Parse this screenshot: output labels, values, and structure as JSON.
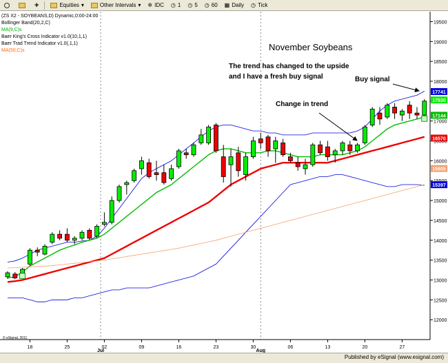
{
  "toolbar": {
    "items": [
      {
        "label": ""
      },
      {
        "label": ""
      },
      {
        "label": "Equities"
      },
      {
        "label": "Other Intervals"
      },
      {
        "label": "IDC"
      },
      {
        "label": "1"
      },
      {
        "label": "5"
      },
      {
        "label": "60"
      },
      {
        "label": "Daily"
      },
      {
        "label": "Tick"
      }
    ]
  },
  "footer": {
    "published": "Published by eSignal (www.esignal.com)"
  },
  "colors": {
    "up_candle": "#00ee00",
    "down_candle": "#ee0000",
    "bollinger": "#0000dd",
    "ma9": "#00bb00",
    "baer_trend": "#ee0000",
    "ma50": "#f4a070"
  },
  "chart_data": {
    "type": "candlestick",
    "legend": [
      {
        "text": "(ZS X2 - SOYBEANS,D) Dynamic,0:00-24:00",
        "color": "#000000"
      },
      {
        "text": "Bollinger Band(20,2,C)",
        "color": "#000000"
      },
      {
        "text": "MA(9,C)s",
        "color": "#00aa00"
      },
      {
        "text": "Baer King's Cross Indicator v1.0(10,1,1)",
        "color": "#000000"
      },
      {
        "text": "Baer Trad Trend Indicator v1.0(,1,1)",
        "color": "#000000"
      },
      {
        "text": "MA(50,C)s",
        "color": "#ff6600"
      }
    ],
    "annotations": [
      {
        "text": "November Soybeans"
      },
      {
        "text": "The trend has changed to the upside"
      },
      {
        "text": "and I have a fresh buy signal"
      },
      {
        "text": "Buy signal"
      },
      {
        "text": "Change in trend"
      }
    ],
    "copyright": "© eSignal, 2011",
    "ylim": [
      11500,
      19750
    ],
    "y_ticks": [
      12000,
      12500,
      13000,
      13500,
      14000,
      14500,
      15000,
      15500,
      16000,
      16500,
      17000,
      17500,
      18000,
      18500,
      19000,
      19500
    ],
    "y_tick_labels": [
      "12000",
      "12500",
      "13000",
      "13500",
      "14000",
      "14500",
      "15000",
      "15500",
      "16000",
      "16500",
      "17000",
      "17500",
      "18000",
      "18500",
      "19000",
      "19500"
    ],
    "x_ticks": [
      {
        "label": "18",
        "index": 3
      },
      {
        "label": "25",
        "index": 8
      },
      {
        "label": "02",
        "index": 13
      },
      {
        "label": "09",
        "index": 18
      },
      {
        "label": "16",
        "index": 23
      },
      {
        "label": "23",
        "index": 28
      },
      {
        "label": "30",
        "index": 33
      },
      {
        "label": "06",
        "index": 38
      },
      {
        "label": "13",
        "index": 43
      },
      {
        "label": "20",
        "index": 48
      },
      {
        "label": "27",
        "index": 53
      }
    ],
    "month_labels": [
      {
        "label": "Jul",
        "index": 13
      },
      {
        "label": "Aug",
        "index": 34.5
      }
    ],
    "month_dividers": [
      13,
      34.5
    ],
    "candles": [
      {
        "o": 13080,
        "h": 13220,
        "l": 13030,
        "c": 13180
      },
      {
        "o": 13150,
        "h": 13200,
        "l": 13020,
        "c": 13050
      },
      {
        "o": 13080,
        "h": 13300,
        "l": 13050,
        "c": 13270
      },
      {
        "o": 13400,
        "h": 13800,
        "l": 13350,
        "c": 13750
      },
      {
        "o": 13750,
        "h": 13820,
        "l": 13600,
        "c": 13700
      },
      {
        "o": 13650,
        "h": 13900,
        "l": 13620,
        "c": 13850
      },
      {
        "o": 13950,
        "h": 14200,
        "l": 13900,
        "c": 14150
      },
      {
        "o": 14150,
        "h": 14250,
        "l": 14000,
        "c": 14050
      },
      {
        "o": 14150,
        "h": 14300,
        "l": 13950,
        "c": 14000
      },
      {
        "o": 14000,
        "h": 14100,
        "l": 13900,
        "c": 14050
      },
      {
        "o": 14050,
        "h": 14250,
        "l": 14000,
        "c": 14200
      },
      {
        "o": 14250,
        "h": 14300,
        "l": 14000,
        "c": 14050
      },
      {
        "o": 14100,
        "h": 14400,
        "l": 14050,
        "c": 14350
      },
      {
        "o": 14400,
        "h": 14700,
        "l": 14350,
        "c": 14450
      },
      {
        "o": 14450,
        "h": 15100,
        "l": 14400,
        "c": 15000
      },
      {
        "o": 15000,
        "h": 15400,
        "l": 14950,
        "c": 15350
      },
      {
        "o": 15400,
        "h": 15500,
        "l": 15150,
        "c": 15450
      },
      {
        "o": 15500,
        "h": 15800,
        "l": 15450,
        "c": 15750
      },
      {
        "o": 15800,
        "h": 16100,
        "l": 15650,
        "c": 16000
      },
      {
        "o": 15950,
        "h": 16050,
        "l": 15550,
        "c": 15600
      },
      {
        "o": 15700,
        "h": 16000,
        "l": 15500,
        "c": 15650
      },
      {
        "o": 15700,
        "h": 15900,
        "l": 15400,
        "c": 15450
      },
      {
        "o": 15550,
        "h": 15900,
        "l": 15500,
        "c": 15800
      },
      {
        "o": 15850,
        "h": 16300,
        "l": 15800,
        "c": 16250
      },
      {
        "o": 16200,
        "h": 16300,
        "l": 16050,
        "c": 16150
      },
      {
        "o": 16150,
        "h": 16450,
        "l": 16100,
        "c": 16400
      },
      {
        "o": 16450,
        "h": 16800,
        "l": 16400,
        "c": 16650
      },
      {
        "o": 16450,
        "h": 16900,
        "l": 16400,
        "c": 16850
      },
      {
        "o": 16900,
        "h": 16950,
        "l": 16200,
        "c": 16250
      },
      {
        "o": 16100,
        "h": 16400,
        "l": 15450,
        "c": 15600
      },
      {
        "o": 15900,
        "h": 16300,
        "l": 15350,
        "c": 16100
      },
      {
        "o": 16200,
        "h": 16350,
        "l": 15600,
        "c": 15750
      },
      {
        "o": 15650,
        "h": 16200,
        "l": 15500,
        "c": 16100
      },
      {
        "o": 16100,
        "h": 16600,
        "l": 16050,
        "c": 16500
      },
      {
        "o": 16550,
        "h": 16700,
        "l": 16300,
        "c": 16450
      },
      {
        "o": 16600,
        "h": 16650,
        "l": 16100,
        "c": 16250
      },
      {
        "o": 16300,
        "h": 16600,
        "l": 15950,
        "c": 16500
      },
      {
        "o": 16450,
        "h": 16550,
        "l": 16100,
        "c": 16150
      },
      {
        "o": 16100,
        "h": 16200,
        "l": 15950,
        "c": 16000
      },
      {
        "o": 15950,
        "h": 16100,
        "l": 15750,
        "c": 15850
      },
      {
        "o": 15800,
        "h": 16050,
        "l": 15650,
        "c": 15900
      },
      {
        "o": 15900,
        "h": 16450,
        "l": 15850,
        "c": 16400
      },
      {
        "o": 16400,
        "h": 16500,
        "l": 16150,
        "c": 16200
      },
      {
        "o": 16350,
        "h": 16500,
        "l": 16000,
        "c": 16100
      },
      {
        "o": 16150,
        "h": 16300,
        "l": 15950,
        "c": 16250
      },
      {
        "o": 16250,
        "h": 16500,
        "l": 16150,
        "c": 16450
      },
      {
        "o": 16400,
        "h": 16500,
        "l": 16150,
        "c": 16250
      },
      {
        "o": 16250,
        "h": 16450,
        "l": 16200,
        "c": 16400
      },
      {
        "o": 16450,
        "h": 16900,
        "l": 16400,
        "c": 16850
      },
      {
        "o": 16900,
        "h": 17350,
        "l": 16850,
        "c": 17300
      },
      {
        "o": 17200,
        "h": 17350,
        "l": 16900,
        "c": 17050
      },
      {
        "o": 17100,
        "h": 17450,
        "l": 17050,
        "c": 17400
      },
      {
        "o": 17350,
        "h": 17450,
        "l": 17050,
        "c": 17200
      },
      {
        "o": 17150,
        "h": 17300,
        "l": 17000,
        "c": 17250
      },
      {
        "o": 17400,
        "h": 17500,
        "l": 17050,
        "c": 17200
      },
      {
        "o": 17200,
        "h": 17350,
        "l": 17050,
        "c": 17150
      },
      {
        "o": 17150,
        "h": 17550,
        "l": 17100,
        "c": 17500
      }
    ],
    "series": [
      {
        "key": "bb_upper",
        "color": "#0000dd",
        "width": 0.8,
        "values": [
          13450,
          13480,
          13550,
          13650,
          13750,
          13800,
          13850,
          13900,
          13950,
          13950,
          13980,
          14000,
          14100,
          14300,
          14550,
          14800,
          15050,
          15300,
          15550,
          15700,
          15800,
          15900,
          16000,
          16150,
          16300,
          16450,
          16600,
          16750,
          16850,
          16900,
          16900,
          16850,
          16800,
          16750,
          16750,
          16700,
          16700,
          16650,
          16650,
          16650,
          16650,
          16700,
          16700,
          16700,
          16700,
          16700,
          16700,
          16750,
          16850,
          17050,
          17250,
          17400,
          17500,
          17550,
          17600,
          17650,
          17750
        ]
      },
      {
        "key": "bb_lower",
        "color": "#0000dd",
        "width": 0.8,
        "values": [
          12550,
          12550,
          12550,
          12500,
          12450,
          12450,
          12500,
          12500,
          12500,
          12550,
          12550,
          12600,
          12650,
          12700,
          12750,
          12750,
          12800,
          12800,
          12800,
          12800,
          12850,
          12900,
          12950,
          13000,
          13050,
          13100,
          13200,
          13300,
          13400,
          13600,
          13800,
          14000,
          14200,
          14400,
          14600,
          14800,
          15000,
          15200,
          15400,
          15450,
          15500,
          15550,
          15600,
          15600,
          15650,
          15650,
          15600,
          15550,
          15500,
          15450,
          15400,
          15350,
          15350,
          15400,
          15400,
          15400,
          15380
        ]
      },
      {
        "key": "ma9",
        "color": "#00bb00",
        "width": 1.4,
        "values": [
          13050,
          13080,
          13200,
          13350,
          13450,
          13550,
          13650,
          13750,
          13820,
          13880,
          13950,
          14000,
          14050,
          14150,
          14300,
          14450,
          14600,
          14750,
          14900,
          15050,
          15200,
          15300,
          15400,
          15550,
          15700,
          15850,
          16000,
          16150,
          16250,
          16300,
          16300,
          16250,
          16200,
          16200,
          16200,
          16250,
          16250,
          16200,
          16150,
          16100,
          16100,
          16100,
          16150,
          16150,
          16150,
          16150,
          16200,
          16250,
          16350,
          16500,
          16650,
          16800,
          16900,
          16950,
          17000,
          17050,
          17100
        ]
      },
      {
        "key": "baer_trend",
        "color": "#ee0000",
        "width": 2.4,
        "values": [
          12950,
          12970,
          13000,
          13050,
          13100,
          13150,
          13200,
          13250,
          13300,
          13350,
          13400,
          13450,
          13500,
          13550,
          13650,
          13750,
          13850,
          13950,
          14050,
          14150,
          14250,
          14350,
          14450,
          14550,
          14650,
          14750,
          14850,
          14950,
          15100,
          15250,
          15400,
          15500,
          15600,
          15700,
          15800,
          15850,
          15900,
          15950,
          15950,
          15950,
          15950,
          15950,
          15950,
          15950,
          16000,
          16050,
          16100,
          16150,
          16200,
          16250,
          16300,
          16350,
          16400,
          16450,
          16500,
          16550,
          16600
        ]
      },
      {
        "key": "ma50",
        "color": "#f4a070",
        "width": 0.8,
        "values": [
          13300,
          13310,
          13320,
          13330,
          13340,
          13350,
          13360,
          13380,
          13400,
          13420,
          13440,
          13460,
          13480,
          13500,
          13530,
          13560,
          13590,
          13620,
          13650,
          13680,
          13710,
          13740,
          13770,
          13800,
          13840,
          13880,
          13920,
          13960,
          14000,
          14050,
          14100,
          14150,
          14200,
          14250,
          14300,
          14350,
          14400,
          14450,
          14500,
          14550,
          14600,
          14650,
          14700,
          14750,
          14800,
          14850,
          14900,
          14950,
          15000,
          15050,
          15100,
          15150,
          15200,
          15250,
          15300,
          15350,
          15400
        ]
      }
    ],
    "price_tags": [
      {
        "text": "17741",
        "value": 17741,
        "bg": "#0000dd",
        "fg": "#ffffff"
      },
      {
        "text": "17530",
        "value": 17530,
        "bg": "#00ee00",
        "fg": "#ffffff"
      },
      {
        "text": "17144",
        "value": 17144,
        "bg": "#00bb00",
        "fg": "#ffffff"
      },
      {
        "text": "16570",
        "value": 16570,
        "bg": "#ee0000",
        "fg": "#ffffff"
      },
      {
        "text": "15805",
        "value": 15805,
        "bg": "#f4a070",
        "fg": "#ffffff"
      },
      {
        "text": "15397",
        "value": 15397,
        "bg": "#0000dd",
        "fg": "#ffffff"
      }
    ],
    "signal_markers": [
      {
        "index": 2,
        "value": 13100
      },
      {
        "index": 56,
        "value": 17060
      }
    ]
  }
}
